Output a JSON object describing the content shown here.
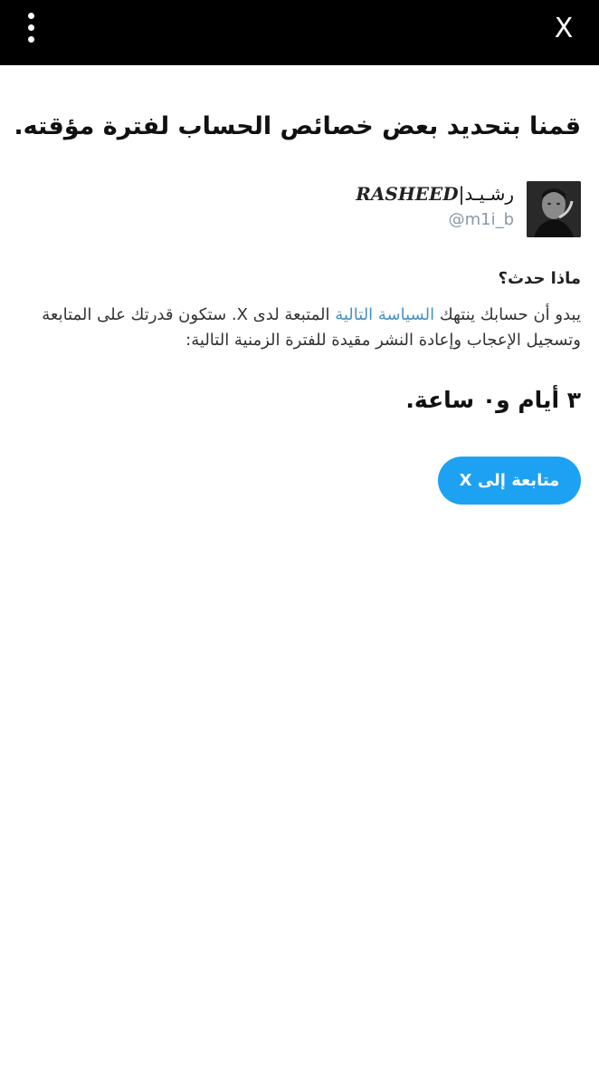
{
  "topbar": {
    "menu_icon": "kebab-menu-icon",
    "close_label": "X"
  },
  "headline": "قمنا بتحديد بعض خصائص الحساب لفترة مؤقته.",
  "user": {
    "display_name_arabic": "رشـيـد|",
    "display_name_latin": "RASHEED",
    "handle": "@m1i_b"
  },
  "section_title": "ماذا حدث؟",
  "body": {
    "part1": "يبدو أن حسابك ينتهك ",
    "policy_link": "السياسة التالية",
    "part2": " المتبعة لدى X. ستكون قدرتك على المتابعة وتسجيل الإعجاب وإعادة النشر مقيدة للفترة الزمنية التالية:"
  },
  "duration": "٣ أيام و٠ ساعة.",
  "continue_button": "متابعة إلى X",
  "colors": {
    "topbar": "#000000",
    "button": "#1da1f2",
    "link": "#4a90c2",
    "handle": "#8899a6"
  }
}
